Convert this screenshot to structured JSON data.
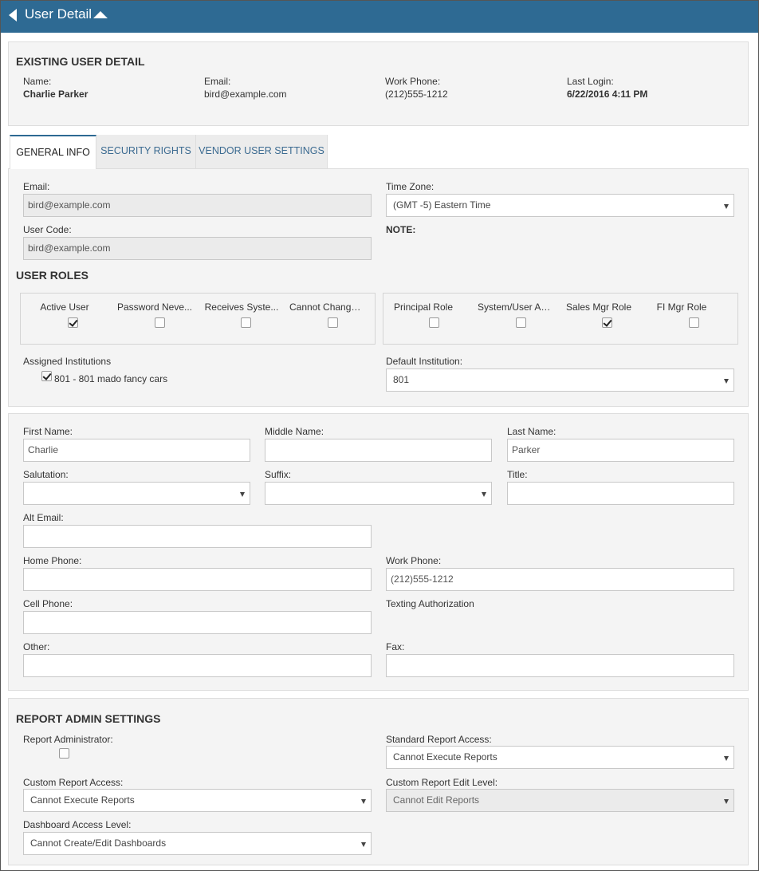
{
  "header": {
    "title": "User Detail"
  },
  "existing": {
    "heading": "EXISTING USER DETAIL",
    "name_label": "Name:",
    "name": "Charlie Parker",
    "email_label": "Email:",
    "email": "bird@example.com",
    "work_phone_label": "Work Phone:",
    "work_phone": "(212)555-1212",
    "last_login_label": "Last Login:",
    "last_login": "6/22/2016 4:11 PM"
  },
  "tabs": [
    {
      "label": "GENERAL INFO"
    },
    {
      "label": "SECURITY RIGHTS"
    },
    {
      "label": "VENDOR USER SETTINGS"
    }
  ],
  "general": {
    "email_label": "Email:",
    "email_value": "bird@example.com",
    "timezone_label": "Time Zone:",
    "timezone_value": "(GMT -5) Eastern Time",
    "usercode_label": "User Code:",
    "usercode_value": "bird@example.com",
    "note_label": "NOTE:",
    "roles_heading": "USER ROLES",
    "flags": [
      {
        "label": "Active User",
        "checked": true
      },
      {
        "label": "Password Neve...",
        "checked": false
      },
      {
        "label": "Receives Syste...",
        "checked": false
      },
      {
        "label": "Cannot Change ...",
        "checked": false
      }
    ],
    "roles": [
      {
        "label": "Principal Role",
        "checked": false
      },
      {
        "label": "System/User Ad...",
        "checked": false
      },
      {
        "label": "Sales Mgr Role",
        "checked": true
      },
      {
        "label": "FI Mgr Role",
        "checked": false
      }
    ],
    "assigned_label": "Assigned Institutions",
    "assigned_item": "801 - 801 mado fancy cars",
    "default_inst_label": "Default Institution:",
    "default_inst_value": "801"
  },
  "contact": {
    "first_name_label": "First Name:",
    "first_name": "Charlie",
    "middle_name_label": "Middle Name:",
    "middle_name": "",
    "last_name_label": "Last Name:",
    "last_name": "Parker",
    "salutation_label": "Salutation:",
    "salutation": "",
    "suffix_label": "Suffix:",
    "suffix": "",
    "title_label": "Title:",
    "title": "",
    "alt_email_label": "Alt Email:",
    "alt_email": "",
    "home_phone_label": "Home Phone:",
    "home_phone": "",
    "work_phone_label": "Work Phone:",
    "work_phone": "(212)555-1212",
    "cell_phone_label": "Cell Phone:",
    "cell_phone": "",
    "texting_label": "Texting Authorization",
    "other_label": "Other:",
    "other": "",
    "fax_label": "Fax:",
    "fax": ""
  },
  "report": {
    "heading": "REPORT ADMIN SETTINGS",
    "admin_label": "Report Administrator:",
    "standard_label": "Standard Report Access:",
    "standard_value": "Cannot Execute Reports",
    "custom_label": "Custom Report Access:",
    "custom_value": "Cannot Execute Reports",
    "custom_edit_label": "Custom Report Edit Level:",
    "custom_edit_value": "Cannot Edit Reports",
    "dashboard_label": "Dashboard Access Level:",
    "dashboard_value": "Cannot Create/Edit Dashboards"
  }
}
